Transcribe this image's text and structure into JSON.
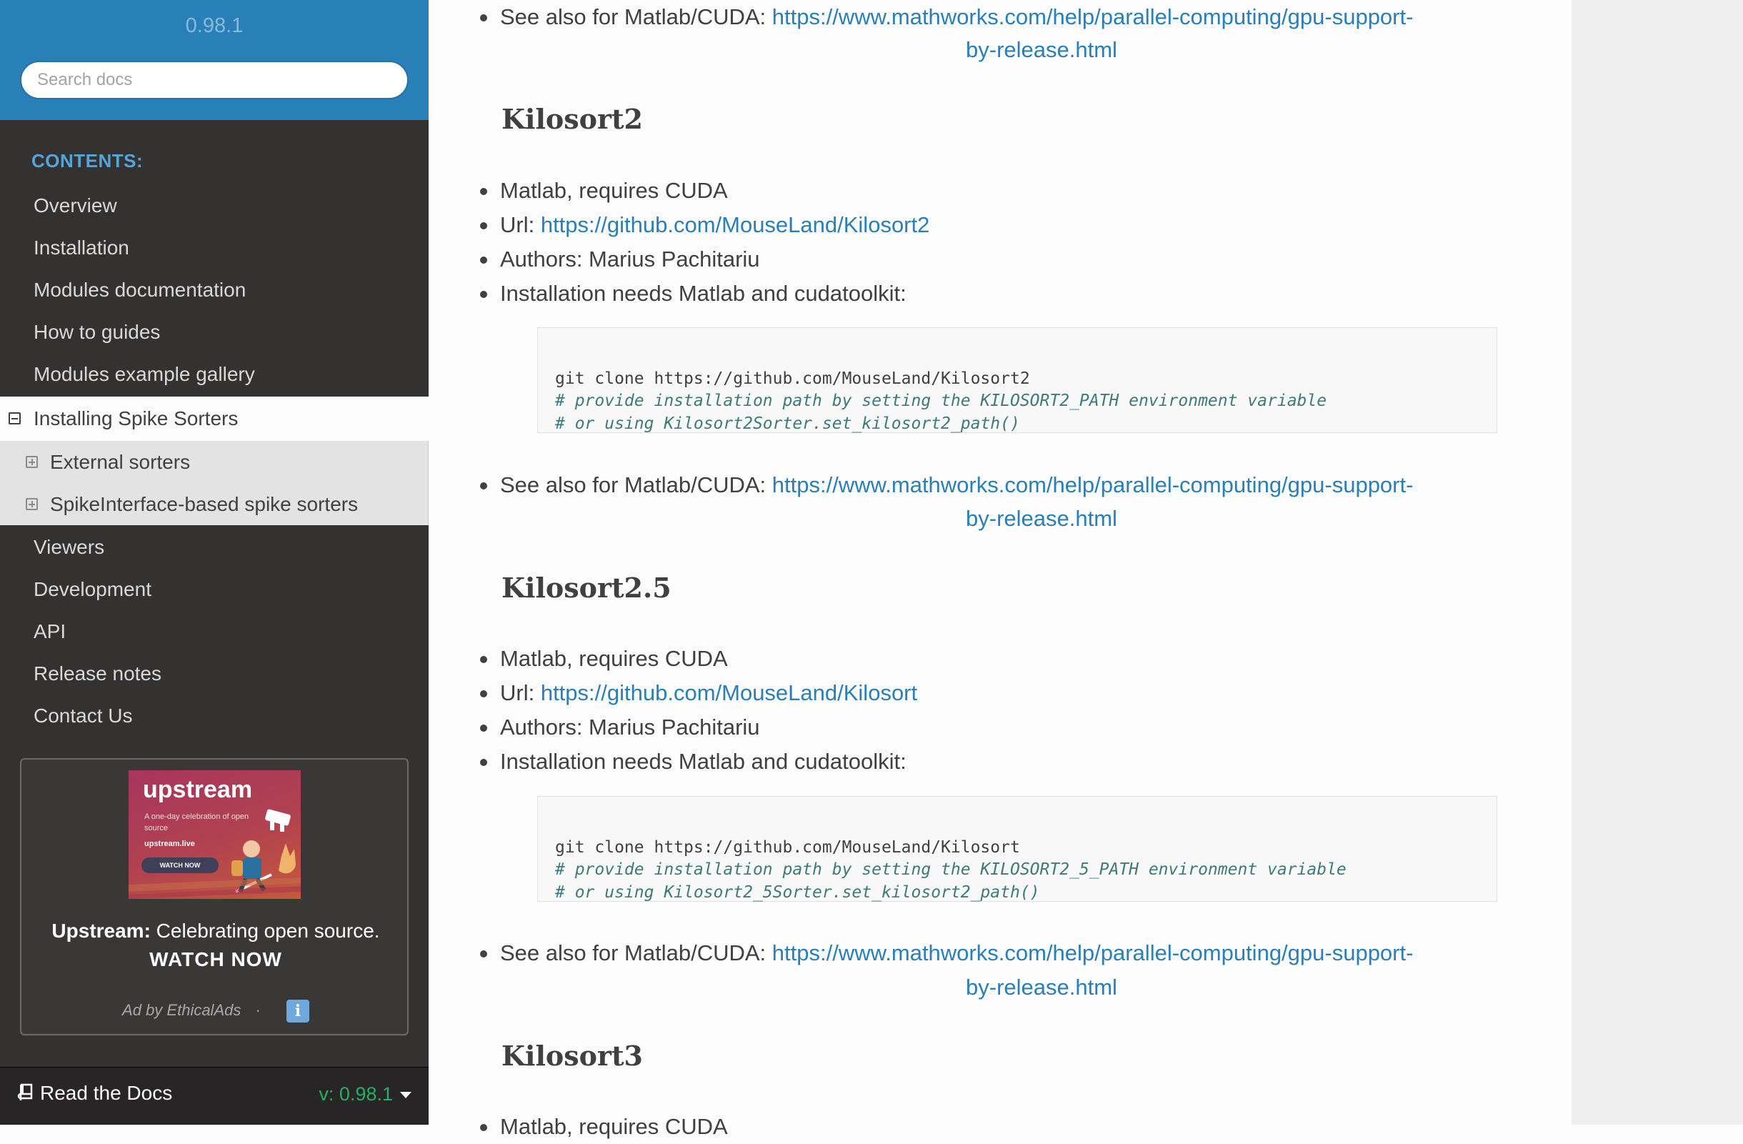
{
  "sidebar": {
    "version": "0.98.1",
    "search_placeholder": "Search docs",
    "contents_caption": "CONTENTS:",
    "nav_top": [
      "Overview",
      "Installation",
      "Modules documentation",
      "How to guides",
      "Modules example gallery"
    ],
    "current": "Installing Spike Sorters",
    "sub_items": [
      "External sorters",
      "SpikeInterface-based spike sorters"
    ],
    "nav_bottom": [
      "Viewers",
      "Development",
      "API",
      "Release notes",
      "Contact Us"
    ],
    "ad": {
      "brand": "upstream",
      "tagline": "A one-day celebration of open source",
      "url": "upstream.live",
      "pill": "WATCH NOW",
      "text_bold": "Upstream:",
      "text": " Celebrating open source.",
      "cta": "WATCH NOW",
      "footer": "Ad by EthicalAds",
      "separator": "·",
      "info": "i"
    },
    "rtd": {
      "label": "Read the Docs",
      "version": "v: 0.98.1"
    }
  },
  "content": {
    "top_see_also": {
      "prefix": "See also for Matlab/CUDA: ",
      "link_part1": "https://www.mathworks.com/help/parallel-computing/gpu-support-",
      "link_part2": "by-release.html"
    },
    "kilosort2": {
      "heading": "Kilosort2",
      "req": "Matlab, requires CUDA",
      "url_label": "Url: ",
      "url": "https://github.com/MouseLand/Kilosort2",
      "authors": "Authors: Marius Pachitariu",
      "install": "Installation needs Matlab and cudatoolkit:",
      "code": [
        "git clone https://github.com/MouseLand/Kilosort2",
        "# provide installation path by setting the KILOSORT2_PATH environment variable",
        "# or using Kilosort2Sorter.set_kilosort2_path()"
      ],
      "see_also_prefix": "See also for Matlab/CUDA: ",
      "see_also_link1": "https://www.mathworks.com/help/parallel-computing/gpu-support-",
      "see_also_link2": "by-release.html"
    },
    "kilosort25": {
      "heading": "Kilosort2.5",
      "req": "Matlab, requires CUDA",
      "url_label": "Url: ",
      "url": "https://github.com/MouseLand/Kilosort",
      "authors": "Authors: Marius Pachitariu",
      "install": "Installation needs Matlab and cudatoolkit:",
      "code": [
        "git clone https://github.com/MouseLand/Kilosort",
        "# provide installation path by setting the KILOSORT2_5_PATH environment variable",
        "# or using Kilosort2_5Sorter.set_kilosort2_path()"
      ],
      "see_also_prefix": "See also for Matlab/CUDA: ",
      "see_also_link1": "https://www.mathworks.com/help/parallel-computing/gpu-support-",
      "see_also_link2": "by-release.html"
    },
    "kilosort3": {
      "heading": "Kilosort3",
      "req": "Matlab, requires CUDA"
    }
  },
  "colors": {
    "sidebar_bg": "#343131",
    "sidebar_top": "#2980b9",
    "link": "#2980b9",
    "rtd_version": "#27ae60"
  }
}
